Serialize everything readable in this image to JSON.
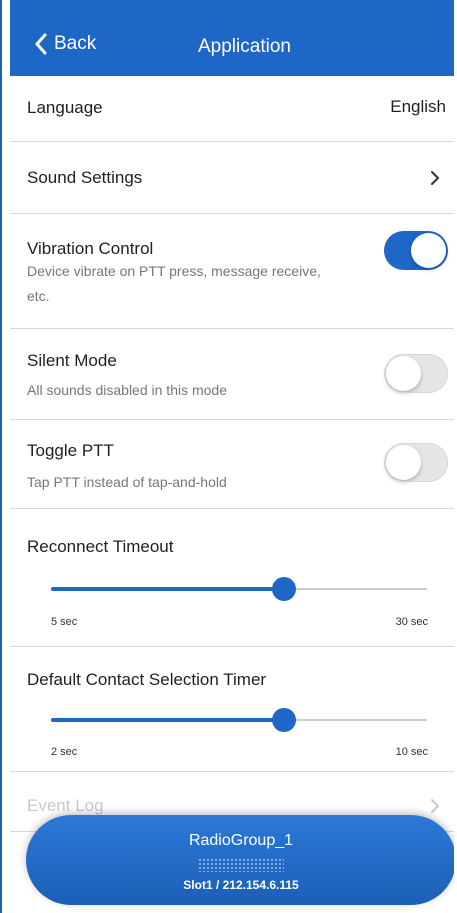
{
  "header": {
    "back_label": "Back",
    "title": "Application"
  },
  "settings": {
    "language": {
      "label": "Language",
      "value": "English"
    },
    "sound": {
      "label": "Sound Settings"
    },
    "vibration": {
      "label": "Vibration Control",
      "description": "Device vibrate on PTT press, message receive, etc.",
      "enabled": true
    },
    "silent": {
      "label": "Silent Mode",
      "description": "All sounds disabled in this mode",
      "enabled": false
    },
    "toggle_ptt": {
      "label": "Toggle PTT",
      "description": "Tap PTT instead of tap-and-hold",
      "enabled": false
    },
    "reconnect_timeout": {
      "label": "Reconnect Timeout",
      "min_label": "5 sec",
      "max_label": "30 sec",
      "fraction": 0.62
    },
    "contact_timer": {
      "label": "Default Contact Selection Timer",
      "min_label": "2 sec",
      "max_label": "10 sec",
      "fraction": 0.62
    },
    "event_log": {
      "label": "Event Log"
    }
  },
  "ptt_button": {
    "group": "RadioGroup_1",
    "slot": "Slot1 / 212.154.6.115"
  },
  "colors": {
    "accent": "#1f67c6",
    "toggle_off": "#e6e6e6",
    "divider": "#d9d9d9"
  },
  "icons": {
    "back": "chevron-left-icon",
    "disclosure": "chevron-right-icon"
  }
}
